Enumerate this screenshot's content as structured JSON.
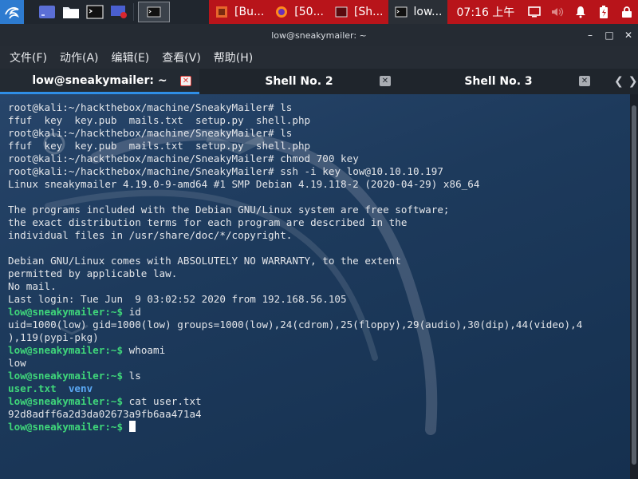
{
  "panel": {
    "launchers": [
      "kali-menu-icon",
      "desktop-icon",
      "files-icon",
      "terminal-icon",
      "screen-icon"
    ],
    "tasks": [
      {
        "label": "[Bu...",
        "icon": "burp-icon"
      },
      {
        "label": "[50...",
        "icon": "firefox-icon"
      },
      {
        "label": "[Sh...",
        "icon": "terminal-icon"
      },
      {
        "label": "low...",
        "icon": "terminal-icon"
      }
    ],
    "clock": "07:16 上午",
    "tray_icons": [
      "display-icon",
      "volume-icon",
      "bell-icon",
      "battery-icon",
      "lock-icon"
    ]
  },
  "window": {
    "title": "low@sneakymailer: ~",
    "controls": {
      "minimize": "–",
      "maximize": "□",
      "close": "✕"
    }
  },
  "menu": [
    "文件(F)",
    "动作(A)",
    "编辑(E)",
    "查看(V)",
    "帮助(H)"
  ],
  "tabs": [
    {
      "label": "low@sneakymailer: ~",
      "active": true
    },
    {
      "label": "Shell No. 2",
      "active": false
    },
    {
      "label": "Shell No. 3",
      "active": false
    }
  ],
  "terminal": {
    "lines": [
      {
        "type": "root",
        "prompt": "root@kali:~/hackthebox/machine/SneakyMailer# ",
        "cmd": "ls"
      },
      {
        "type": "out",
        "text": "ffuf  key  key.pub  mails.txt  setup.py  shell.php"
      },
      {
        "type": "root",
        "prompt": "root@kali:~/hackthebox/machine/SneakyMailer# ",
        "cmd": "ls"
      },
      {
        "type": "out",
        "text": "ffuf  key  key.pub  mails.txt  setup.py  shell.php"
      },
      {
        "type": "root",
        "prompt": "root@kali:~/hackthebox/machine/SneakyMailer# ",
        "cmd": "chmod 700 key"
      },
      {
        "type": "root",
        "prompt": "root@kali:~/hackthebox/machine/SneakyMailer# ",
        "cmd": "ssh -i key low@10.10.10.197"
      },
      {
        "type": "out",
        "text": "Linux sneakymailer 4.19.0-9-amd64 #1 SMP Debian 4.19.118-2 (2020-04-29) x86_64"
      },
      {
        "type": "out",
        "text": ""
      },
      {
        "type": "out",
        "text": "The programs included with the Debian GNU/Linux system are free software;"
      },
      {
        "type": "out",
        "text": "the exact distribution terms for each program are described in the"
      },
      {
        "type": "out",
        "text": "individual files in /usr/share/doc/*/copyright."
      },
      {
        "type": "out",
        "text": ""
      },
      {
        "type": "out",
        "text": "Debian GNU/Linux comes with ABSOLUTELY NO WARRANTY, to the extent"
      },
      {
        "type": "out",
        "text": "permitted by applicable law."
      },
      {
        "type": "out",
        "text": "No mail."
      },
      {
        "type": "out",
        "text": "Last login: Tue Jun  9 03:02:52 2020 from 192.168.56.105"
      },
      {
        "type": "user",
        "prompt": "low@sneakymailer:~$ ",
        "cmd": "id"
      },
      {
        "type": "out",
        "text": "uid=1000(low) gid=1000(low) groups=1000(low),24(cdrom),25(floppy),29(audio),30(dip),44(video),4"
      },
      {
        "type": "out",
        "text": "),119(pypi-pkg)"
      },
      {
        "type": "user",
        "prompt": "low@sneakymailer:~$ ",
        "cmd": "whoami"
      },
      {
        "type": "out",
        "text": "low"
      },
      {
        "type": "user",
        "prompt": "low@sneakymailer:~$ ",
        "cmd": "ls"
      },
      {
        "type": "ls",
        "items": [
          "user.txt",
          "venv"
        ]
      },
      {
        "type": "user",
        "prompt": "low@sneakymailer:~$ ",
        "cmd": "cat user.txt"
      },
      {
        "type": "out",
        "text": "92d8adff6a2d3da02673a9fb6aa471a4"
      },
      {
        "type": "user",
        "prompt": "low@sneakymailer:~$ ",
        "cmd": "",
        "cursor": true
      }
    ]
  },
  "colors": {
    "panel_red": "#b8141a",
    "prompt_green": "#3fd67a",
    "dir_blue": "#5aa8f5",
    "tab_accent": "#2f8ee6"
  }
}
